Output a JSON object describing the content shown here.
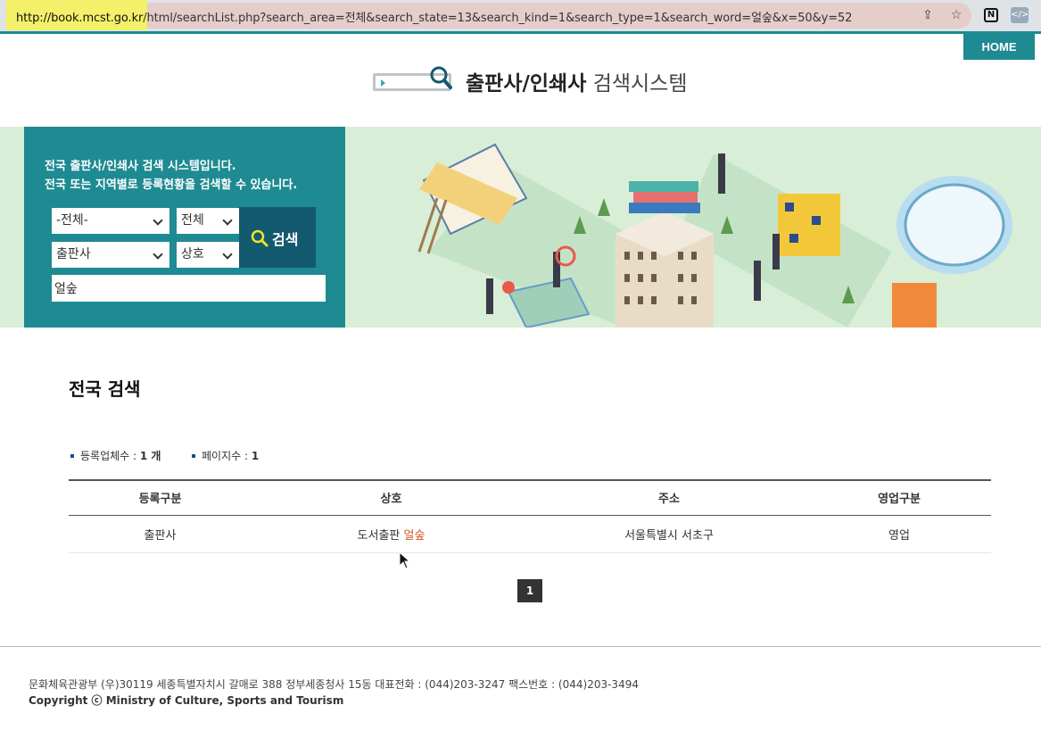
{
  "browser": {
    "url_host": "http://book.mcst.go.kr",
    "url_rest": "/html/searchList.php?search_area=전체&search_state=13&search_kind=1&search_type=1&search_word=얼숲&x=50&y=52"
  },
  "header": {
    "home_label": "HOME",
    "title_bold": "출판사/인쇄사",
    "title_rest": "검색시스템"
  },
  "banner": {
    "desc_line1": "전국 출판사/인쇄사 검색 시스템입니다.",
    "desc_line2": "전국 또는 지역별로 등록현황을 검색할 수 있습니다.",
    "area_select": "-전체-",
    "state_select": "전체",
    "kind_select": "출판사",
    "type_select": "상호",
    "search_word": "얼숲",
    "search_button": "검색"
  },
  "main": {
    "title": "전국 검색",
    "count_label": "등록업체수 :",
    "count_value": "1 개",
    "pages_label": "페이지수 :",
    "pages_value": "1",
    "columns": [
      "등록구분",
      "상호",
      "주소",
      "영업구분"
    ],
    "rows": [
      {
        "type": "출판사",
        "name_prefix": "도서출판 ",
        "name_highlight": "얼숲",
        "address": "서울특별시 서초구",
        "status": "영업"
      }
    ],
    "current_page": "1"
  },
  "footer": {
    "address": "문화체육관광부 (우)30119 세종특별자치시 갈매로 388 정부세종청사 15동 대표전화 : (044)203-3247 팩스번호 : (044)203-3494",
    "copyright": "Copyright ⓒ Ministry of Culture, Sports and Tourism"
  },
  "colors": {
    "teal": "#1e8a92",
    "dark_teal": "#135a6f",
    "highlight": "#d3572a",
    "banner_bg": "#d9eed6"
  }
}
